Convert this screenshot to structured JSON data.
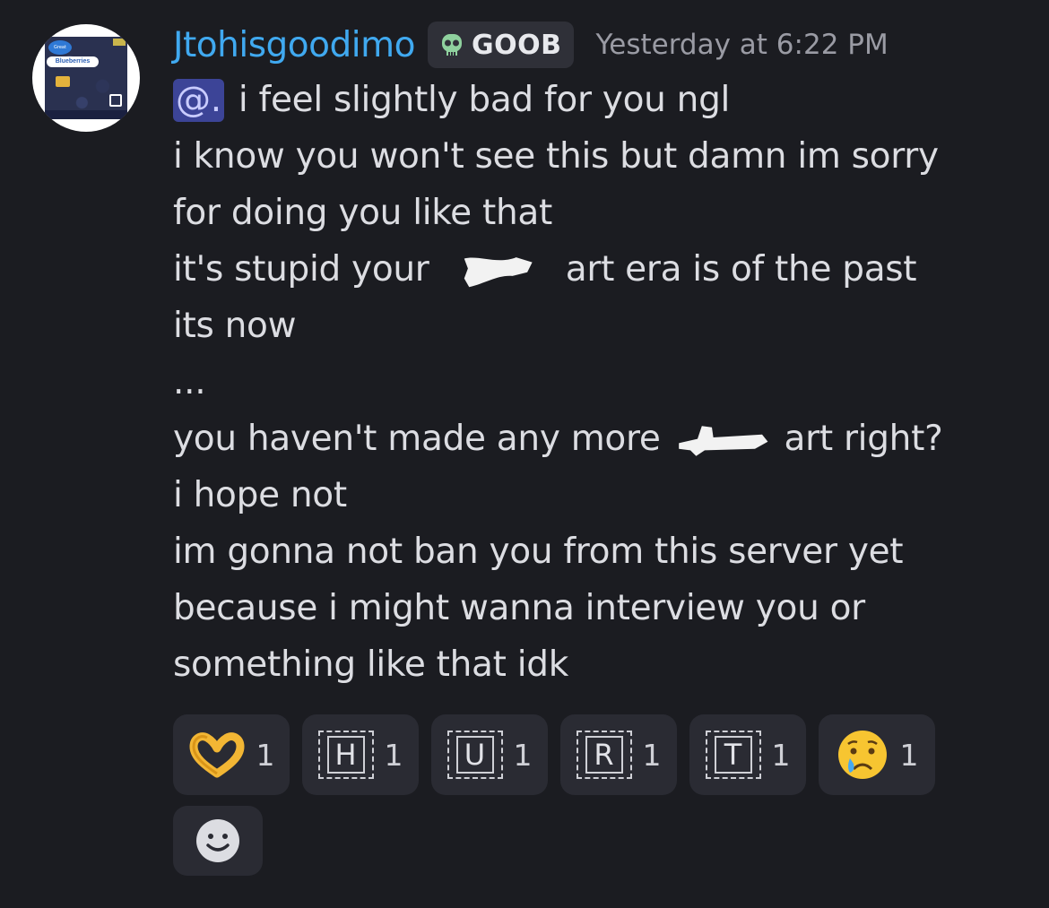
{
  "message": {
    "username": "Jtohisgoodimo",
    "tag": "GOOB",
    "timestamp": "Yesterday at 6:22 PM",
    "avatar": {
      "badge_text": "Great Value",
      "label": "Blueberries"
    },
    "mention": "@.",
    "lines": [
      "i feel slightly bad for you ngl",
      "i know you won't see this but damn im sorry",
      "for doing you like that",
      "it's stupid your",
      "art era is of the past",
      "its now",
      "...",
      "you haven't made any more",
      "art right?",
      "i hope not",
      "im gonna not ban you from this server yet",
      "because i might wanna interview you or",
      "something like that idk"
    ]
  },
  "reactions": [
    {
      "icon": "heart-hands-icon",
      "emoji": "🫶",
      "count": "1"
    },
    {
      "icon": "regional-indicator-h-icon",
      "letter": "H",
      "count": "1"
    },
    {
      "icon": "regional-indicator-u-icon",
      "letter": "U",
      "count": "1"
    },
    {
      "icon": "regional-indicator-r-icon",
      "letter": "R",
      "count": "1"
    },
    {
      "icon": "regional-indicator-t-icon",
      "letter": "T",
      "count": "1"
    },
    {
      "icon": "crying-face-icon",
      "emoji": "😢",
      "count": "1"
    }
  ],
  "colors": {
    "background": "#1b1c21",
    "username": "#40a9f0",
    "mention_bg": "#3c4497",
    "reaction_bg": "#2a2b33"
  }
}
